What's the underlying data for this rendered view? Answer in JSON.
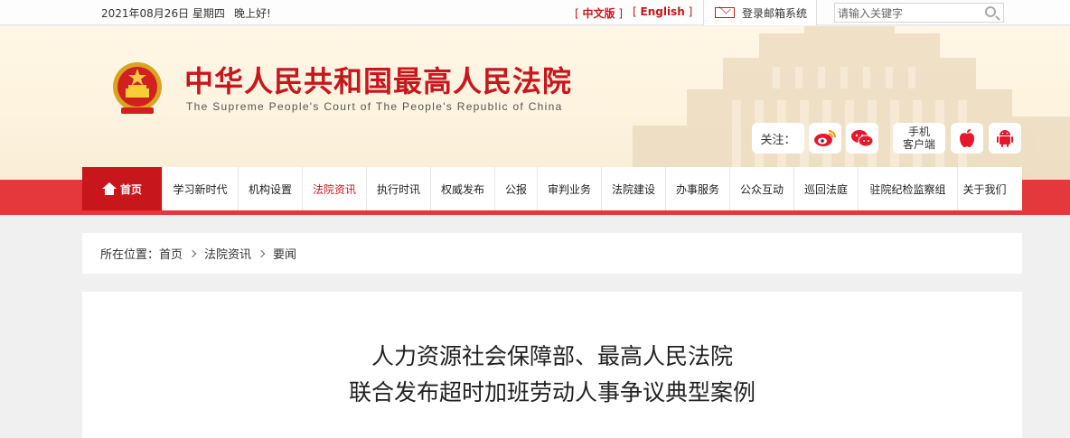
{
  "topbar": {
    "date": "2021年08月26日  星期四",
    "greeting": "晚上好!",
    "lang_cn": "中文版",
    "lang_en": "English",
    "mail_label": "登录邮箱系统",
    "search_placeholder": "请输入关键字"
  },
  "header": {
    "title": "中华人民共和国最高人民法院",
    "subtitle": "The Supreme People's Court of The People's Republic of China",
    "follow_label": "关注：",
    "mobile_line1": "手机",
    "mobile_line2": "客户端"
  },
  "nav": {
    "items": [
      {
        "label": "首页"
      },
      {
        "label": "学习新时代"
      },
      {
        "label": "机构设置"
      },
      {
        "label": "法院资讯"
      },
      {
        "label": "执行时讯"
      },
      {
        "label": "权威发布"
      },
      {
        "label": "公报"
      },
      {
        "label": "审判业务"
      },
      {
        "label": "法院建设"
      },
      {
        "label": "办事服务"
      },
      {
        "label": "公众互动"
      },
      {
        "label": "巡回法庭"
      },
      {
        "label": "驻院纪检监察组"
      },
      {
        "label": "关于我们"
      }
    ]
  },
  "breadcrumb": {
    "prefix": "所在位置：",
    "items": [
      "首页",
      "法院资讯",
      "要闻"
    ]
  },
  "article": {
    "title_line1": "人力资源社会保障部、最高人民法院",
    "title_line2": "联合发布超时加班劳动人事争议典型案例"
  },
  "colors": {
    "brand_red": "#c8161d",
    "nav_strip": "#e4393c",
    "header_bg": "#fdf3df"
  },
  "icons": [
    "mail-icon",
    "search-icon",
    "national-emblem-icon",
    "weibo-icon",
    "wechat-icon",
    "apple-icon",
    "android-icon",
    "home-icon",
    "chevron-right-icon"
  ]
}
